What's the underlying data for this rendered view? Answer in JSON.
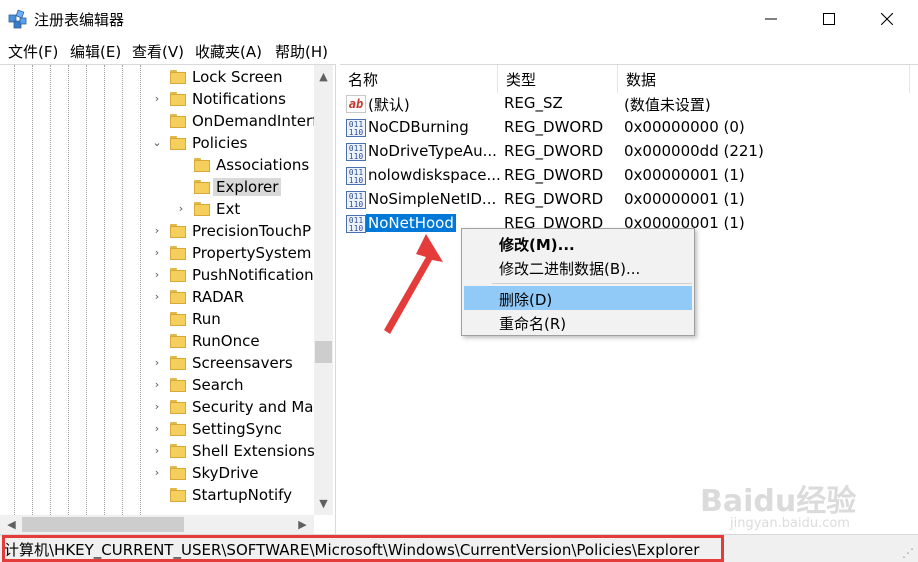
{
  "window": {
    "title": "注册表编辑器",
    "controls": {
      "minimize": "—",
      "maximize": "☐",
      "close": "✕"
    }
  },
  "menu": [
    {
      "label": "文件(F)"
    },
    {
      "label": "编辑(E)"
    },
    {
      "label": "查看(V)"
    },
    {
      "label": "收藏夹(A)"
    },
    {
      "label": "帮助(H)"
    }
  ],
  "tree": [
    {
      "label": "Lock Screen",
      "level": 1,
      "expand": "none"
    },
    {
      "label": "Notifications",
      "level": 1,
      "expand": "collapsed"
    },
    {
      "label": "OnDemandInterf",
      "level": 1,
      "expand": "none"
    },
    {
      "label": "Policies",
      "level": 1,
      "expand": "expanded"
    },
    {
      "label": "Associations",
      "level": 2,
      "expand": "none"
    },
    {
      "label": "Explorer",
      "level": 2,
      "expand": "none",
      "selected": true
    },
    {
      "label": "Ext",
      "level": 2,
      "expand": "collapsed"
    },
    {
      "label": "PrecisionTouchP",
      "level": 1,
      "expand": "collapsed"
    },
    {
      "label": "PropertySystem",
      "level": 1,
      "expand": "collapsed"
    },
    {
      "label": "PushNotification",
      "level": 1,
      "expand": "collapsed"
    },
    {
      "label": "RADAR",
      "level": 1,
      "expand": "collapsed"
    },
    {
      "label": "Run",
      "level": 1,
      "expand": "none"
    },
    {
      "label": "RunOnce",
      "level": 1,
      "expand": "none"
    },
    {
      "label": "Screensavers",
      "level": 1,
      "expand": "collapsed"
    },
    {
      "label": "Search",
      "level": 1,
      "expand": "collapsed"
    },
    {
      "label": "Security and Mai",
      "level": 1,
      "expand": "collapsed"
    },
    {
      "label": "SettingSync",
      "level": 1,
      "expand": "collapsed"
    },
    {
      "label": "Shell Extensions",
      "level": 1,
      "expand": "collapsed"
    },
    {
      "label": "SkyDrive",
      "level": 1,
      "expand": "collapsed"
    },
    {
      "label": "StartupNotify",
      "level": 1,
      "expand": "none"
    }
  ],
  "columns": {
    "name": "名称",
    "type": "类型",
    "data": "数据"
  },
  "values": [
    {
      "name": "(默认)",
      "type": "REG_SZ",
      "data": "(数值未设置)",
      "icon": "ab-string-icon"
    },
    {
      "name": "NoCDBurning",
      "type": "REG_DWORD",
      "data": "0x00000000 (0)",
      "icon": "binary-value-icon"
    },
    {
      "name": "NoDriveTypeAu...",
      "type": "REG_DWORD",
      "data": "0x000000dd (221)",
      "icon": "binary-value-icon"
    },
    {
      "name": "nolowdiskspace...",
      "type": "REG_DWORD",
      "data": "0x00000001 (1)",
      "icon": "binary-value-icon"
    },
    {
      "name": "NoSimpleNetID...",
      "type": "REG_DWORD",
      "data": "0x00000001 (1)",
      "icon": "binary-value-icon"
    },
    {
      "name": "NoNetHood",
      "type": "REG_DWORD",
      "data": "0x00000001 (1)",
      "icon": "binary-value-icon",
      "selected": true
    }
  ],
  "context_menu": {
    "modify": "修改(M)...",
    "modify_binary": "修改二进制数据(B)...",
    "delete": "删除(D)",
    "rename": "重命名(R)"
  },
  "status": {
    "path": "计算机\\HKEY_CURRENT_USER\\SOFTWARE\\Microsoft\\Windows\\CurrentVersion\\Policies\\Explorer"
  },
  "watermark": {
    "text": "Baidu经验",
    "sub": "jingyan.baidu.com"
  },
  "colors": {
    "selection": "#0078d7",
    "menu_hover": "#91c9f7",
    "annotation": "#e43b3b"
  }
}
